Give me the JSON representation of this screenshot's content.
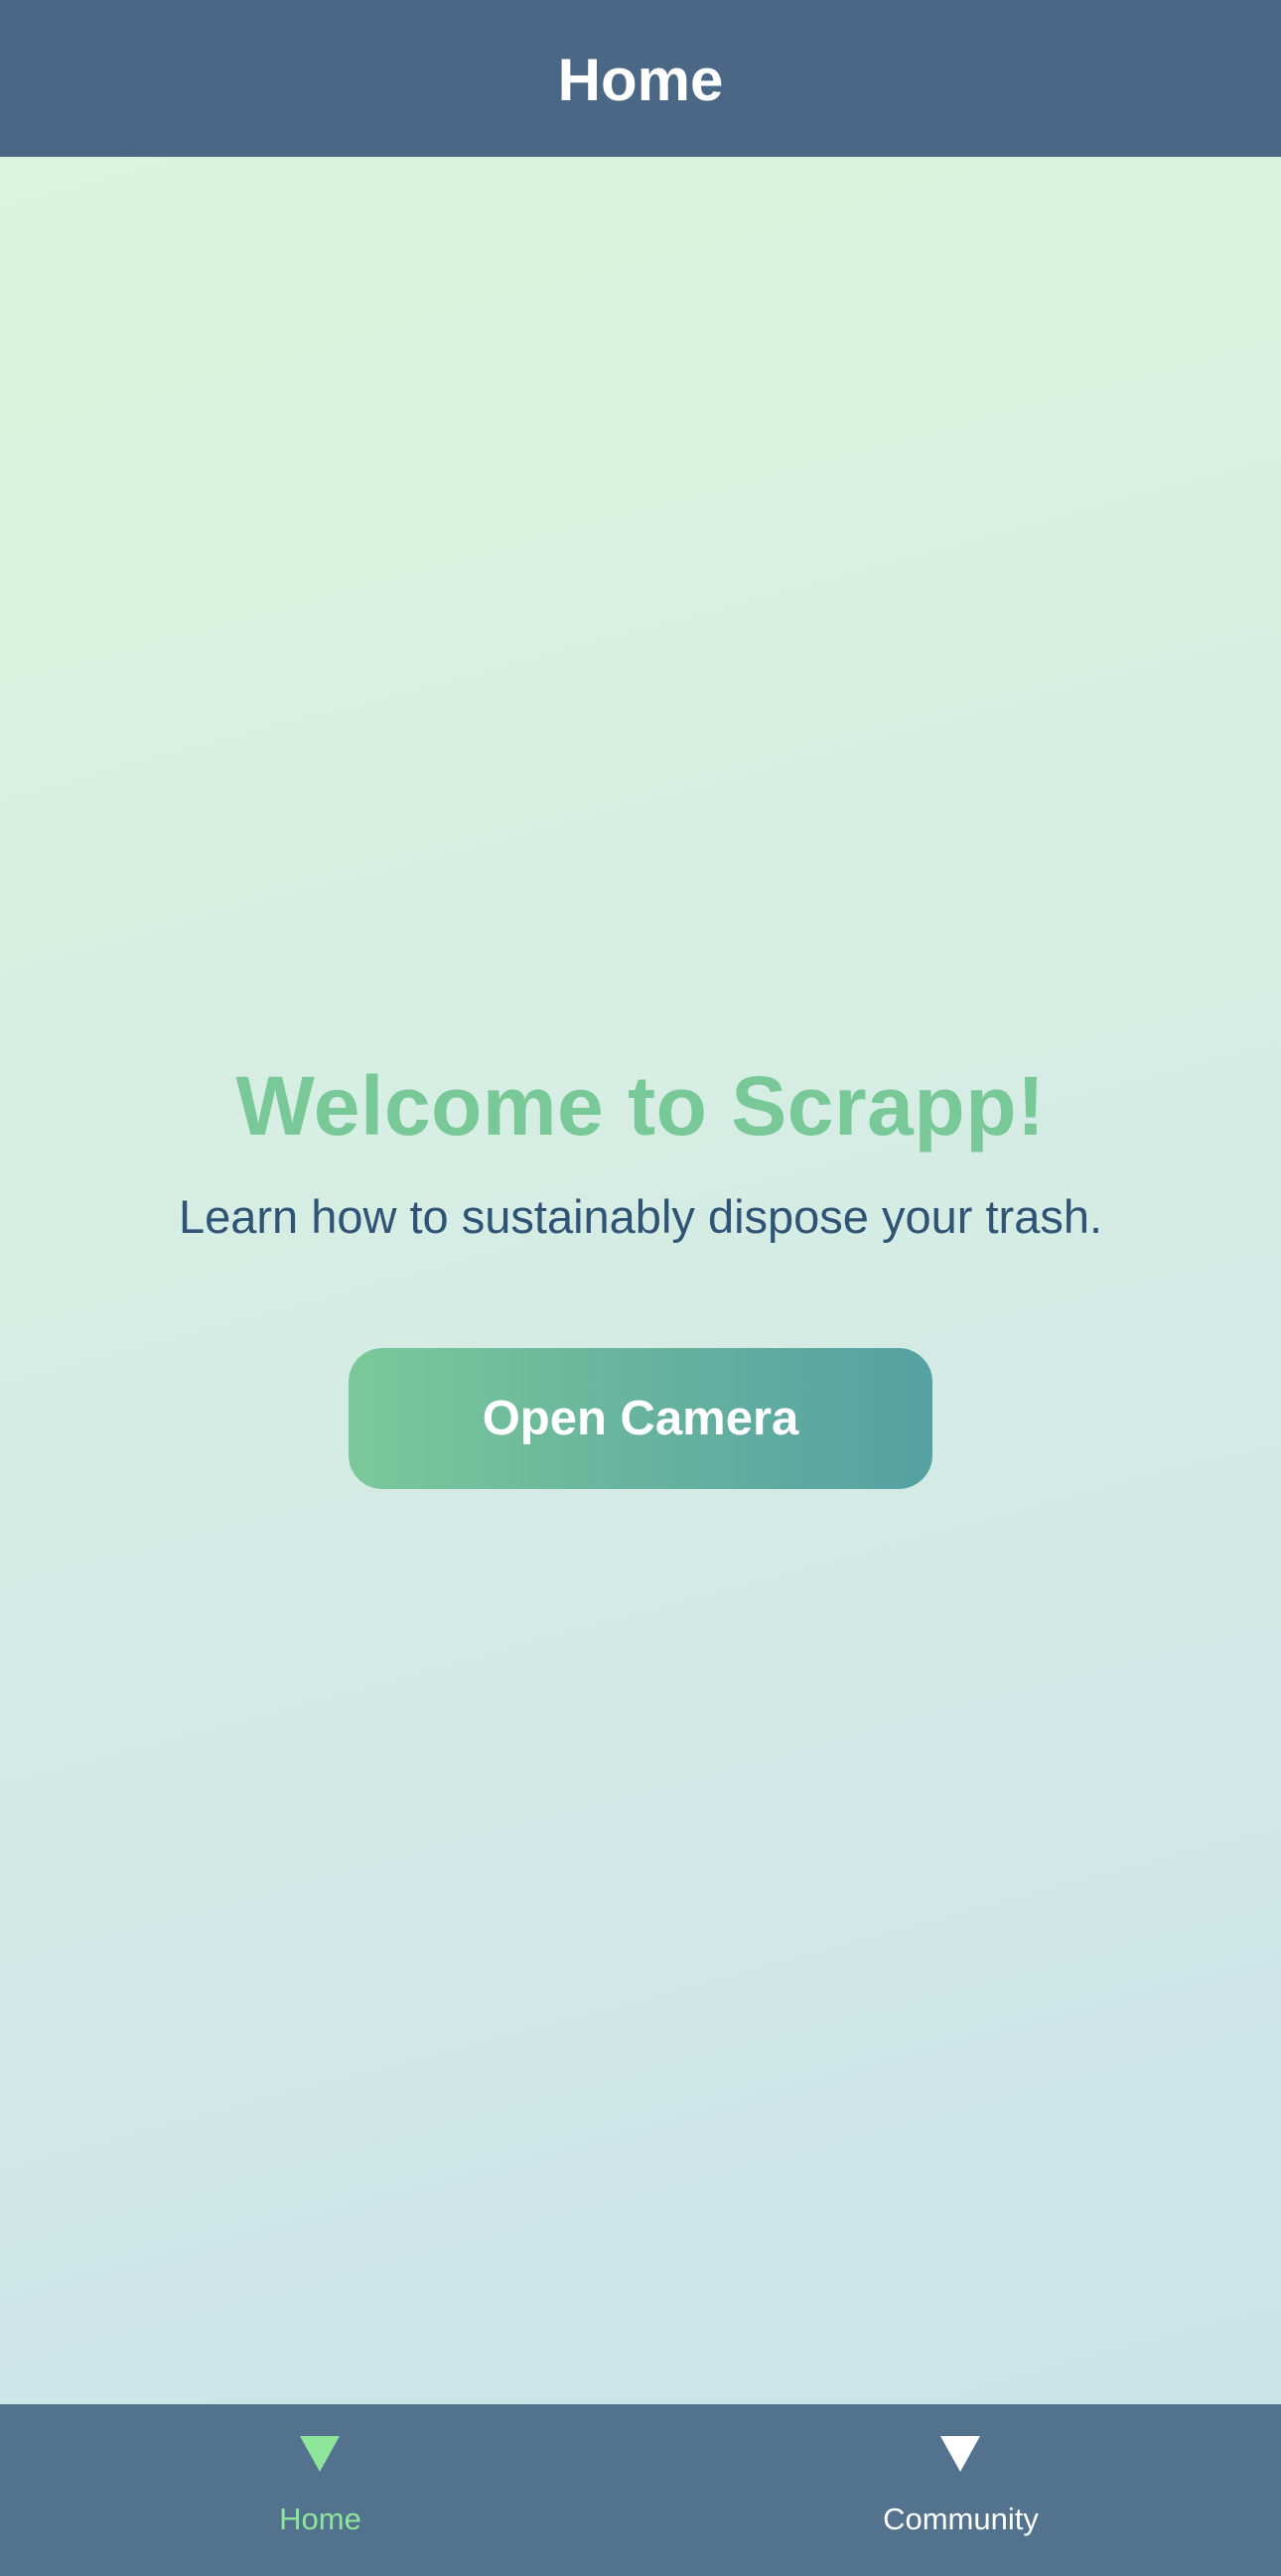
{
  "header": {
    "title": "Home"
  },
  "main": {
    "welcome_title": "Welcome to Scrapp!",
    "subtitle": "Learn how to sustainably dispose your trash.",
    "open_camera_label": "Open Camera"
  },
  "tabbar": {
    "items": [
      {
        "label": "Home",
        "icon": "triangle-down-icon",
        "active": true,
        "color": "#8de69a"
      },
      {
        "label": "Community",
        "icon": "triangle-down-icon",
        "active": false,
        "color": "#ffffff"
      }
    ]
  },
  "colors": {
    "header_bg": "#4a6885",
    "tabbar_bg": "#53728e",
    "accent_green": "#78c898",
    "subtitle_text": "#2f5475",
    "button_gradient_start": "#7bc99a",
    "button_gradient_end": "#55a1a3"
  }
}
